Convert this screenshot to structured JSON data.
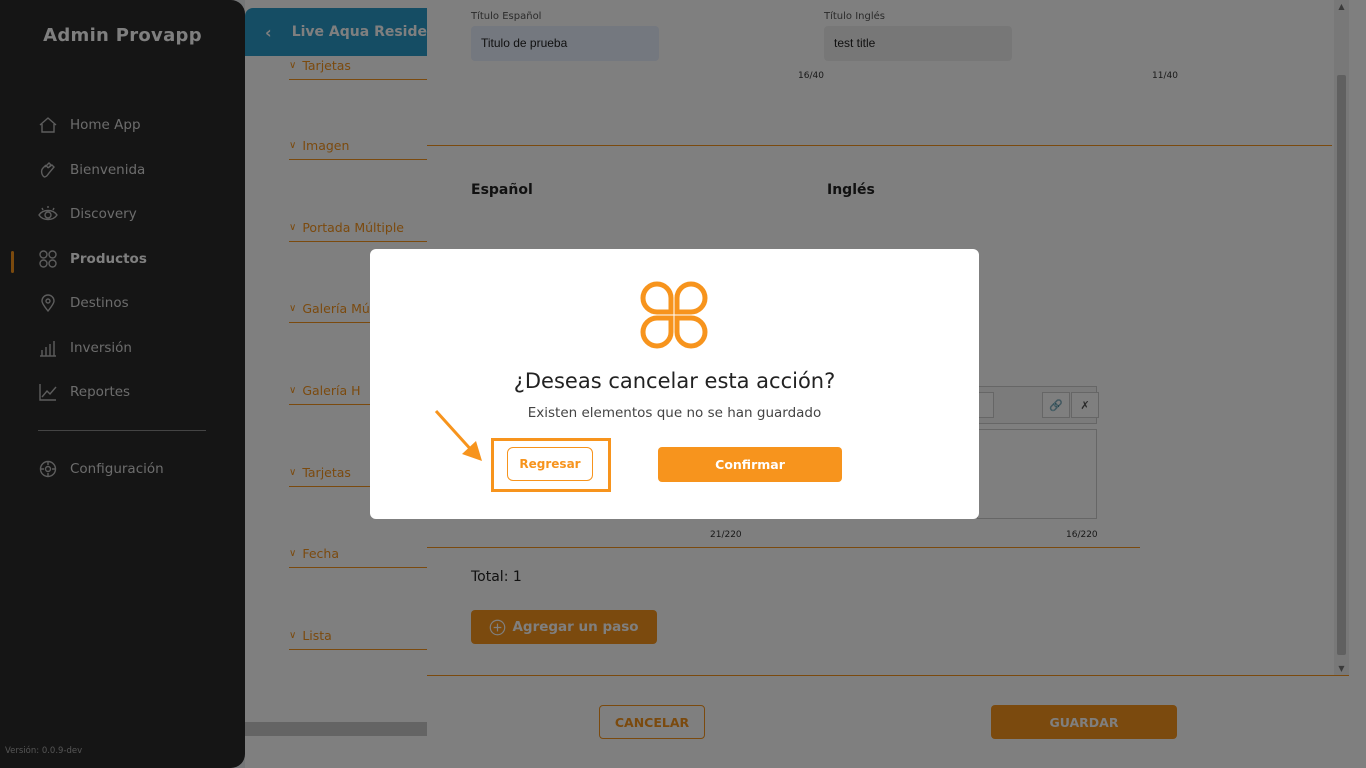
{
  "sidebar": {
    "brand": "Admin Provapp",
    "items": [
      {
        "label": "Home App",
        "icon": "home-icon"
      },
      {
        "label": "Bienvenida",
        "icon": "hand-wave-icon"
      },
      {
        "label": "Discovery",
        "icon": "eye-icon"
      },
      {
        "label": "Productos",
        "icon": "grid-icon",
        "active": true
      },
      {
        "label": "Destinos",
        "icon": "location-pin-icon"
      },
      {
        "label": "Inversión",
        "icon": "bar-chart-icon"
      },
      {
        "label": "Reportes",
        "icon": "line-chart-icon"
      }
    ],
    "settings": {
      "label": "Configuración",
      "icon": "gear-icon"
    },
    "version": "Versión: 0.0.9-dev"
  },
  "middle": {
    "header_title": "Live Aqua Reside",
    "sections": [
      "Tarjetas",
      "Imagen",
      "Portada Múltiple",
      "Galería Mú",
      "Galería H",
      "Tarjetas",
      "Fecha",
      "Lista"
    ]
  },
  "form": {
    "title_es_label": "Título Español",
    "title_es_value": "Titulo de prueba",
    "title_es_counter": "16/40",
    "title_en_label": "Título Inglés",
    "title_en_value": "test title",
    "title_en_counter": "11/40",
    "col_es": "Español",
    "col_en": "Inglés",
    "desc_es_counter": "21/220",
    "desc_en_counter": "16/220",
    "total": "Total: 1",
    "add_step": "Agregar un paso",
    "cancel": "CANCELAR",
    "save": "GUARDAR"
  },
  "modal": {
    "title": "¿Deseas cancelar esta acción?",
    "subtitle": "Existen elementos que no se han guardado",
    "back_label": "Regresar",
    "confirm_label": "Confirmar"
  },
  "colors": {
    "accent": "#f7941d",
    "sidebar_bg": "#2b2b2b",
    "header_blue": "#2b9bc8"
  }
}
